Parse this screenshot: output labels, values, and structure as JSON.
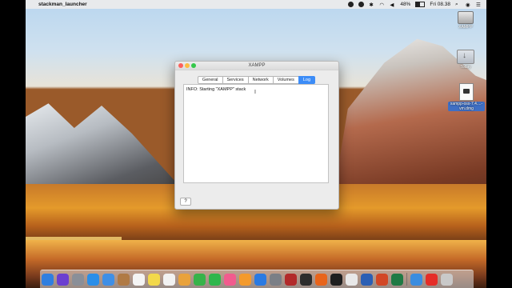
{
  "menubar": {
    "app_name": "stackman_launcher",
    "battery_percent": "48%",
    "clock": "Fri 08.38"
  },
  "desktop_icons": [
    {
      "label": "XAMPP",
      "type": "disk"
    },
    {
      "label": "Today",
      "type": "folder"
    },
    {
      "label": "xampp-osx-7.4....-vm.dmg",
      "type": "dmg"
    }
  ],
  "window": {
    "title": "XAMPP",
    "tabs": [
      {
        "label": "General",
        "active": false
      },
      {
        "label": "Services",
        "active": false
      },
      {
        "label": "Network",
        "active": false
      },
      {
        "label": "Volumes",
        "active": false
      },
      {
        "label": "Log",
        "active": true
      }
    ],
    "log_text": "INFO: Starting \"XAMPP\" stack",
    "help_label": "?"
  },
  "dock": {
    "apps": [
      {
        "name": "Finder",
        "color": "#2f7fe0"
      },
      {
        "name": "Siri",
        "color": "#6b3fd0"
      },
      {
        "name": "Launchpad",
        "color": "#8a8f98"
      },
      {
        "name": "Safari",
        "color": "#2a8ee8"
      },
      {
        "name": "Mail",
        "color": "#3f8fe6"
      },
      {
        "name": "Contacts",
        "color": "#b07a45"
      },
      {
        "name": "Calendar",
        "color": "#f4f4f4"
      },
      {
        "name": "Notes",
        "color": "#f3d94a"
      },
      {
        "name": "Reminders",
        "color": "#f2f2f2"
      },
      {
        "name": "Photos",
        "color": "#e9a23b"
      },
      {
        "name": "Messages",
        "color": "#37b34a"
      },
      {
        "name": "FaceTime",
        "color": "#2fb64c"
      },
      {
        "name": "iTunes",
        "color": "#f25b8e"
      },
      {
        "name": "iBooks",
        "color": "#f49a2c"
      },
      {
        "name": "App Store",
        "color": "#2a7ae2"
      },
      {
        "name": "System Preferences",
        "color": "#7b7f86"
      },
      {
        "name": "Photo Booth",
        "color": "#b22a2a"
      },
      {
        "name": "Console",
        "color": "#2d2d2d"
      },
      {
        "name": "Firefox",
        "color": "#e8641b"
      },
      {
        "name": "Terminal",
        "color": "#1f1f1f"
      },
      {
        "name": "Chrome",
        "color": "#e8e8e8"
      },
      {
        "name": "Word",
        "color": "#2b5fb4"
      },
      {
        "name": "PowerPoint",
        "color": "#d24726"
      },
      {
        "name": "Excel",
        "color": "#1f7a44"
      },
      {
        "name": "Downloads",
        "color": "#3b8de0"
      },
      {
        "name": "YouTube",
        "color": "#e52d27"
      },
      {
        "name": "Trash",
        "color": "#c9c9c9"
      }
    ]
  }
}
